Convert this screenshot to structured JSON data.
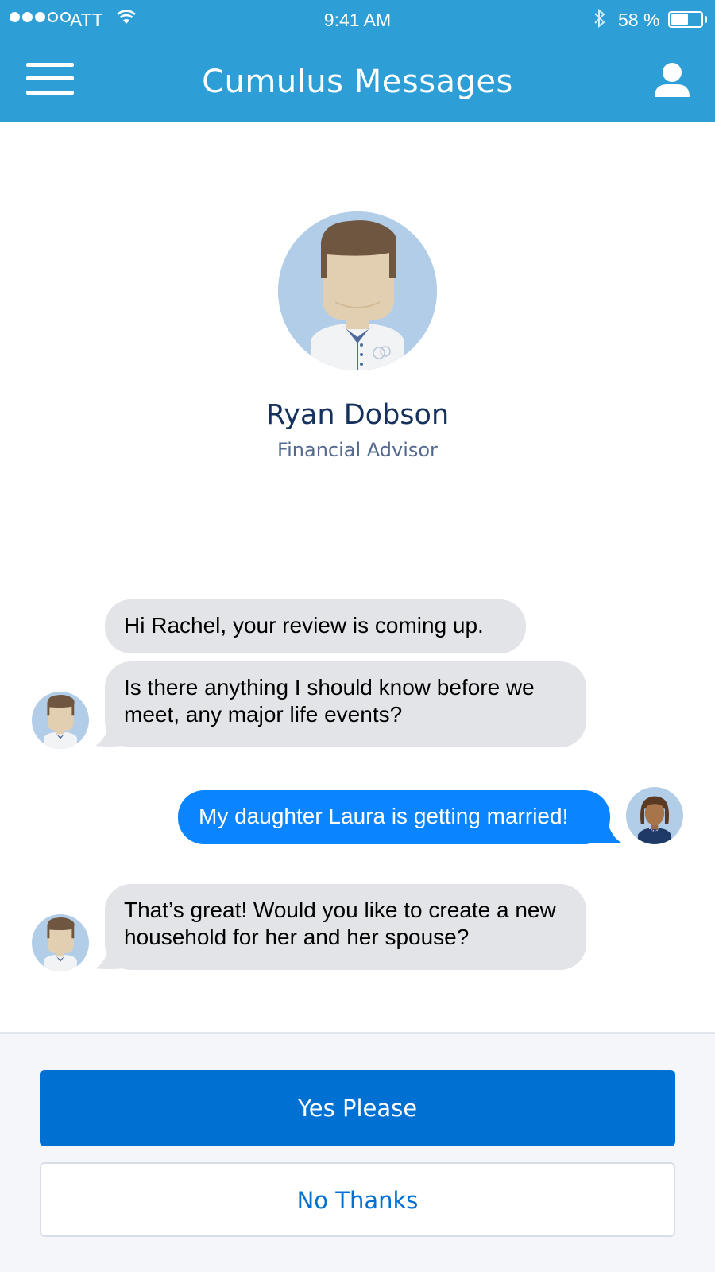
{
  "status_bar": {
    "carrier": "ATT",
    "time": "9:41 AM",
    "battery": "58 %",
    "battery_level": 0.58
  },
  "header": {
    "title": "Cumulus Messages",
    "menu_icon": "hamburger-menu-icon",
    "profile_icon": "user-icon"
  },
  "advisor": {
    "name": "Ryan Dobson",
    "title": "Financial Advisor"
  },
  "messages": [
    {
      "sender": "advisor",
      "text": "Hi Rachel, your review is coming up."
    },
    {
      "sender": "advisor",
      "text": "Is there anything I should know before we meet, any major life events?"
    },
    {
      "sender": "user",
      "text": "My daughter Laura is getting married!"
    },
    {
      "sender": "advisor",
      "text": "That’s great! Would you like to create a new household for her and her spouse?"
    }
  ],
  "actions": {
    "yes_label": "Yes Please",
    "no_label": "No Thanks"
  },
  "colors": {
    "header": "#2e9fd6",
    "incoming_bubble": "#e3e4e8",
    "outgoing_bubble": "#0a84ff",
    "primary_button": "#0070d2",
    "name_text": "#16325c"
  }
}
